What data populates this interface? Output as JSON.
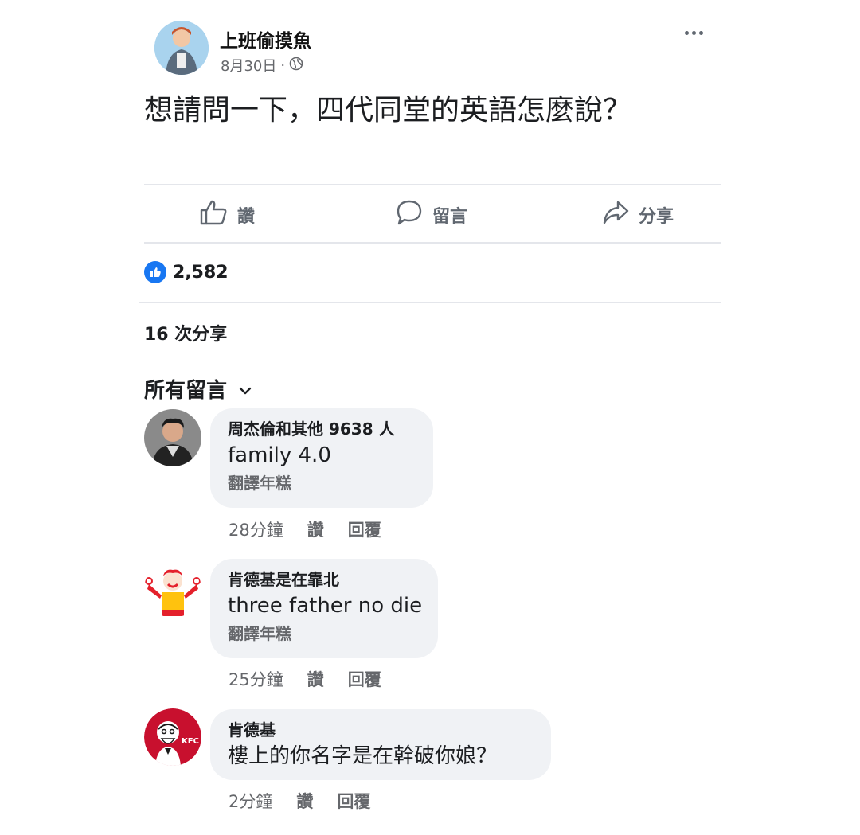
{
  "post": {
    "page_name": "上班偷摸魚",
    "date": "8月30日",
    "separator": "·",
    "privacy_icon": "globe-icon",
    "text": "想請問一下，四代同堂的英語怎麼說？"
  },
  "actions": {
    "like_label": "讚",
    "comment_label": "留言",
    "share_label": "分享"
  },
  "stats": {
    "likes_count": "2,582",
    "shares_text": "16 次分享"
  },
  "comments_filter": {
    "label": "所有留言"
  },
  "comments": [
    {
      "name": "周杰倫和其他 9638 人",
      "text": "family 4.0",
      "translate": "翻譯年糕",
      "time": "28分鐘",
      "like": "讚",
      "reply": "回覆"
    },
    {
      "name": "肯德基是在靠北",
      "text": "three father no die",
      "translate": "翻譯年糕",
      "time": "25分鐘",
      "like": "讚",
      "reply": "回覆"
    },
    {
      "name": "肯德基",
      "text": "樓上的你名字是在幹破你娘？",
      "time": "2分鐘",
      "like": "讚",
      "reply": "回覆"
    }
  ],
  "kfc_logo_text": "KFC",
  "colors": {
    "facebook_blue": "#1877f2",
    "secondary_text": "#65676b",
    "bubble_bg": "#f0f2f5",
    "kfc_red": "#c8102e"
  }
}
